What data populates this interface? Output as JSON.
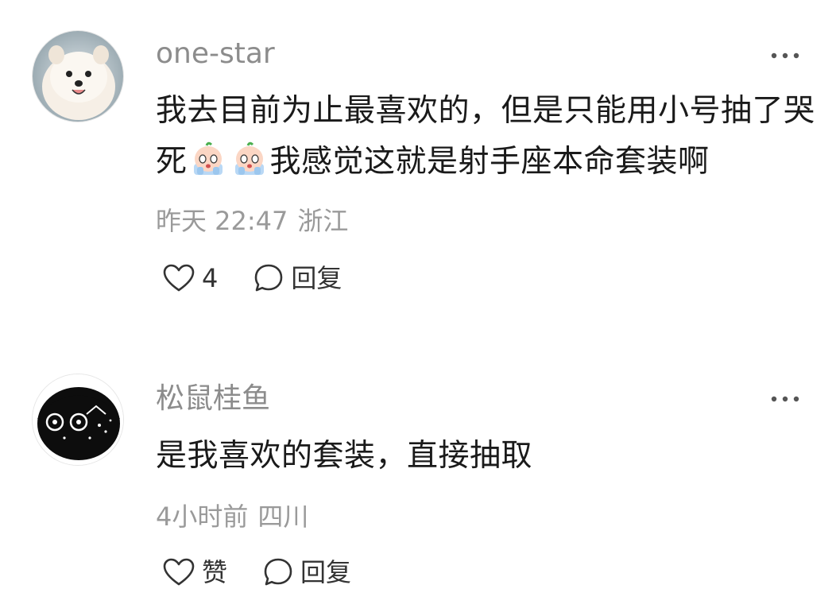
{
  "comments": [
    {
      "username": "one-star",
      "avatar_icon": "pomeranian-dog-avatar",
      "text_part1": "我去目前为止最喜欢的，但是只能用小号抽了哭死",
      "emoji_icon": "crying-face-emoji",
      "text_part2": "我感觉这就是射手座本命套装啊",
      "time": "昨天 22:47",
      "location": "浙江",
      "like_label": "4",
      "reply_label": "回复"
    },
    {
      "username": "松鼠桂鱼",
      "avatar_icon": "dark-cartoon-avatar",
      "text": "是我喜欢的套装，直接抽取",
      "time": "4小时前",
      "location": "四川",
      "like_label": "赞",
      "reply_label": "回复"
    }
  ],
  "icons": {
    "like": "heart-outline-icon",
    "reply": "speech-bubble-icon",
    "more": "more-dots-icon"
  },
  "colors": {
    "username": "#8c8c8c",
    "meta": "#9a9a9a",
    "text": "#1a1a1a",
    "action": "#333333"
  }
}
